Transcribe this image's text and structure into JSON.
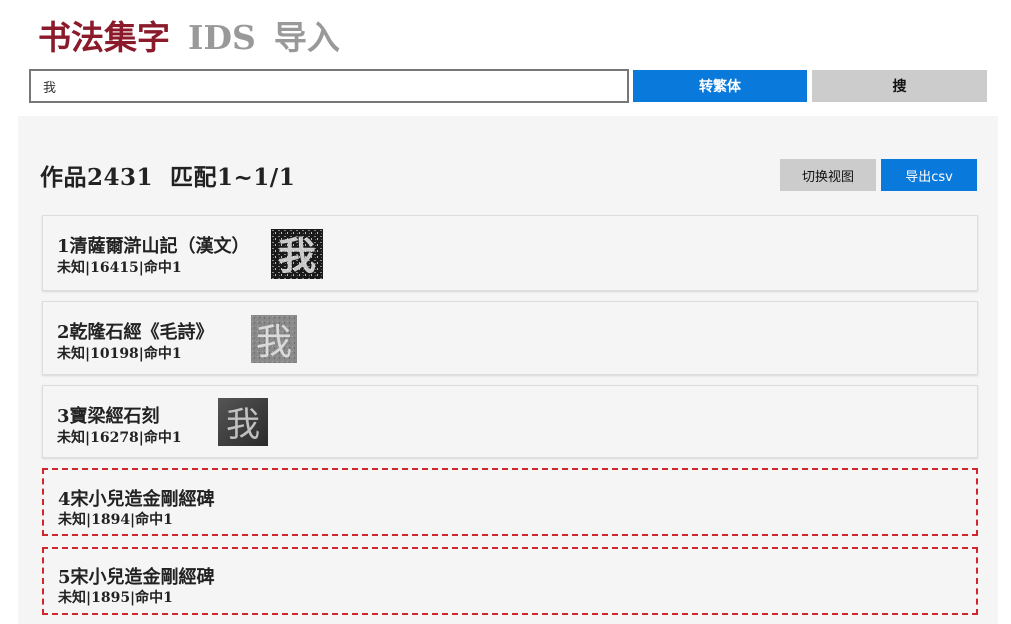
{
  "header": {
    "brand": "书法集字",
    "ids_link": "IDS",
    "import_link": "导入"
  },
  "search": {
    "value": "我",
    "convert_label": "转繁体",
    "search_label": "搜"
  },
  "results": {
    "summary": "作品2431  匹配1~1/1",
    "toggle_view_label": "切换视图",
    "export_label": "导出csv",
    "items": [
      {
        "title": "1清薩爾滸山記（漢文）",
        "meta": "未知|16415|命中1",
        "glyph": "我"
      },
      {
        "title": "2乾隆石經《毛詩》",
        "meta": "未知|10198|命中1",
        "glyph": "我"
      },
      {
        "title": "3寶梁經石刻",
        "meta": "未知|16278|命中1",
        "glyph": "我"
      },
      {
        "title": "4宋小兒造金剛經碑",
        "meta": "未知|1894|命中1"
      },
      {
        "title": "5宋小兒造金剛經碑",
        "meta": "未知|1895|命中1"
      }
    ]
  },
  "colors": {
    "brand": "#8b1a2b",
    "accent": "#0a79dc",
    "missing_border": "#d0262c"
  }
}
